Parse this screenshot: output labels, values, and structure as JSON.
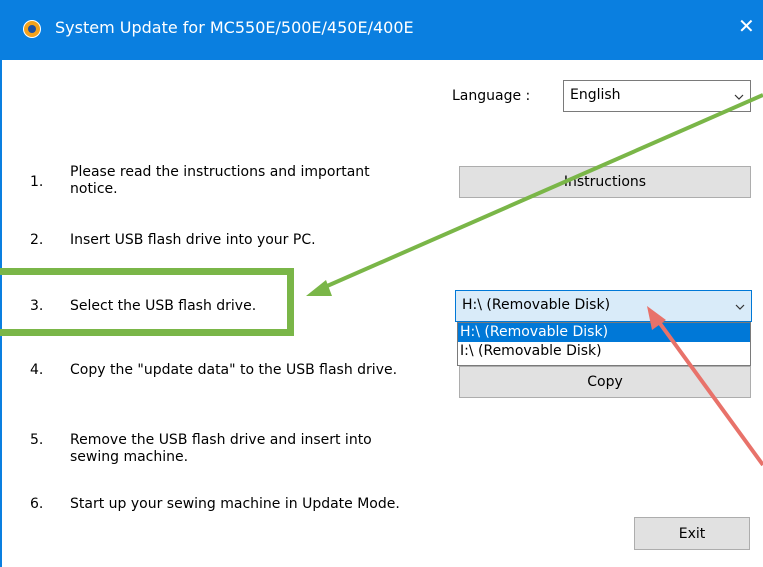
{
  "window": {
    "title": "System Update for MC550E/500E/450E/400E"
  },
  "language": {
    "label": "Language :",
    "value": "English"
  },
  "steps": [
    {
      "num": "1.",
      "text": "Please read the instructions and important notice."
    },
    {
      "num": "2.",
      "text": "Insert USB flash drive into your PC."
    },
    {
      "num": "3.",
      "text": "Select the USB flash drive."
    },
    {
      "num": "4.",
      "text": "Copy the \"update data\" to the USB flash drive."
    },
    {
      "num": "5.",
      "text": "Remove the USB flash drive and insert into sewing machine."
    },
    {
      "num": "6.",
      "text": "Start up your sewing machine in Update Mode."
    }
  ],
  "buttons": {
    "instructions": "Instructions",
    "copy": "Copy",
    "exit": "Exit"
  },
  "drive": {
    "value": "H:\\ (Removable Disk)",
    "options": [
      "H:\\ (Removable Disk)",
      "I:\\ (Removable Disk)"
    ]
  },
  "colors": {
    "titlebar": "#0a7fe0",
    "green_annotation": "#7ab648",
    "red_annotation": "#e8726a",
    "selection": "#0078d7"
  },
  "icons": {
    "app": "app-icon",
    "close": "close-icon",
    "dropdown": "chevron-down-icon"
  }
}
